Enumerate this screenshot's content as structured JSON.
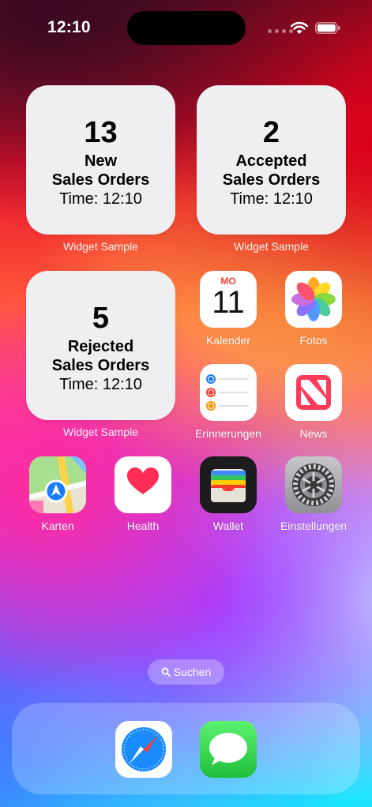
{
  "status_bar": {
    "time": "12:10"
  },
  "widgets": [
    {
      "number": "13",
      "line1": "New",
      "line2": "Sales Orders",
      "time": "Time: 12:10",
      "caption": "Widget Sample"
    },
    {
      "number": "2",
      "line1": "Accepted",
      "line2": "Sales Orders",
      "time": "Time: 12:10",
      "caption": "Widget Sample"
    },
    {
      "number": "5",
      "line1": "Rejected",
      "line2": "Sales Orders",
      "time": "Time: 12:10",
      "caption": "Widget Sample"
    }
  ],
  "apps": {
    "kalender": {
      "label": "Kalender",
      "day": "MO",
      "date": "11",
      "icon": "calendar-icon"
    },
    "fotos": {
      "label": "Fotos",
      "icon": "photos-icon"
    },
    "erinnerungen": {
      "label": "Erinnerungen",
      "icon": "reminders-icon"
    },
    "news": {
      "label": "News",
      "icon": "news-icon"
    },
    "karten": {
      "label": "Karten",
      "icon": "maps-icon"
    },
    "health": {
      "label": "Health",
      "icon": "health-icon"
    },
    "wallet": {
      "label": "Wallet",
      "icon": "wallet-icon"
    },
    "einstellungen": {
      "label": "Einstellungen",
      "icon": "settings-icon"
    }
  },
  "search": {
    "label": "Suchen"
  },
  "dock": [
    {
      "name": "safari",
      "icon": "safari-icon"
    },
    {
      "name": "messages",
      "icon": "messages-icon"
    }
  ],
  "colors": {
    "widget_bg": "#efeff2",
    "calendar_red": "#ff3b30",
    "health_red": "#ff2d55",
    "messages_green": "#34c759",
    "safari_blue": "#1a8cff"
  }
}
